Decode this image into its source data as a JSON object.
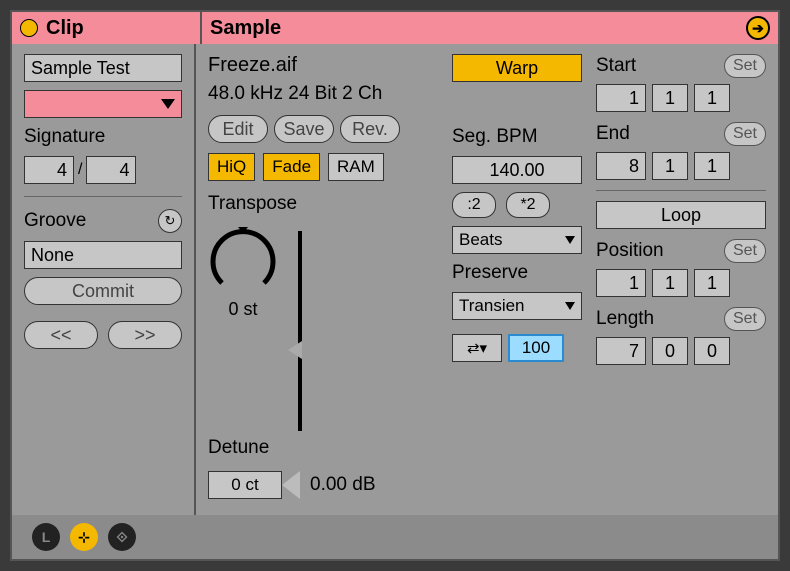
{
  "clip": {
    "header": "Clip",
    "name": "Sample Test",
    "signature_label": "Signature",
    "sig_num": "4",
    "sig_den": "4",
    "groove_label": "Groove",
    "groove_value": "None",
    "commit": "Commit",
    "prev": "<<",
    "next": ">>"
  },
  "sample": {
    "header": "Sample",
    "filename": "Freeze.aif",
    "fileinfo": "48.0 kHz 24 Bit 2 Ch",
    "edit": "Edit",
    "save": "Save",
    "rev": "Rev.",
    "hiq": "HiQ",
    "fade": "Fade",
    "ram": "RAM",
    "transpose_label": "Transpose",
    "transpose_value": "0 st",
    "detune_label": "Detune",
    "detune_value": "0 ct",
    "gain": "0.00 dB"
  },
  "warp": {
    "warp": "Warp",
    "seg_bpm_label": "Seg. BPM",
    "seg_bpm": "140.00",
    "half": ":2",
    "dbl": "*2",
    "mode": "Beats",
    "preserve_label": "Preserve",
    "preserve": "Transien",
    "loop_icon": "⇄▾",
    "loop_amount": "100"
  },
  "range": {
    "start_label": "Start",
    "end_label": "End",
    "set": "Set",
    "start": [
      "1",
      "1",
      "1"
    ],
    "end": [
      "8",
      "1",
      "1"
    ],
    "loop_label": "Loop",
    "position_label": "Position",
    "position": [
      "1",
      "1",
      "1"
    ],
    "length_label": "Length",
    "length": [
      "7",
      "0",
      "0"
    ]
  },
  "footer": {
    "l": "L",
    "mid": "⊹",
    "link": "⟐"
  }
}
